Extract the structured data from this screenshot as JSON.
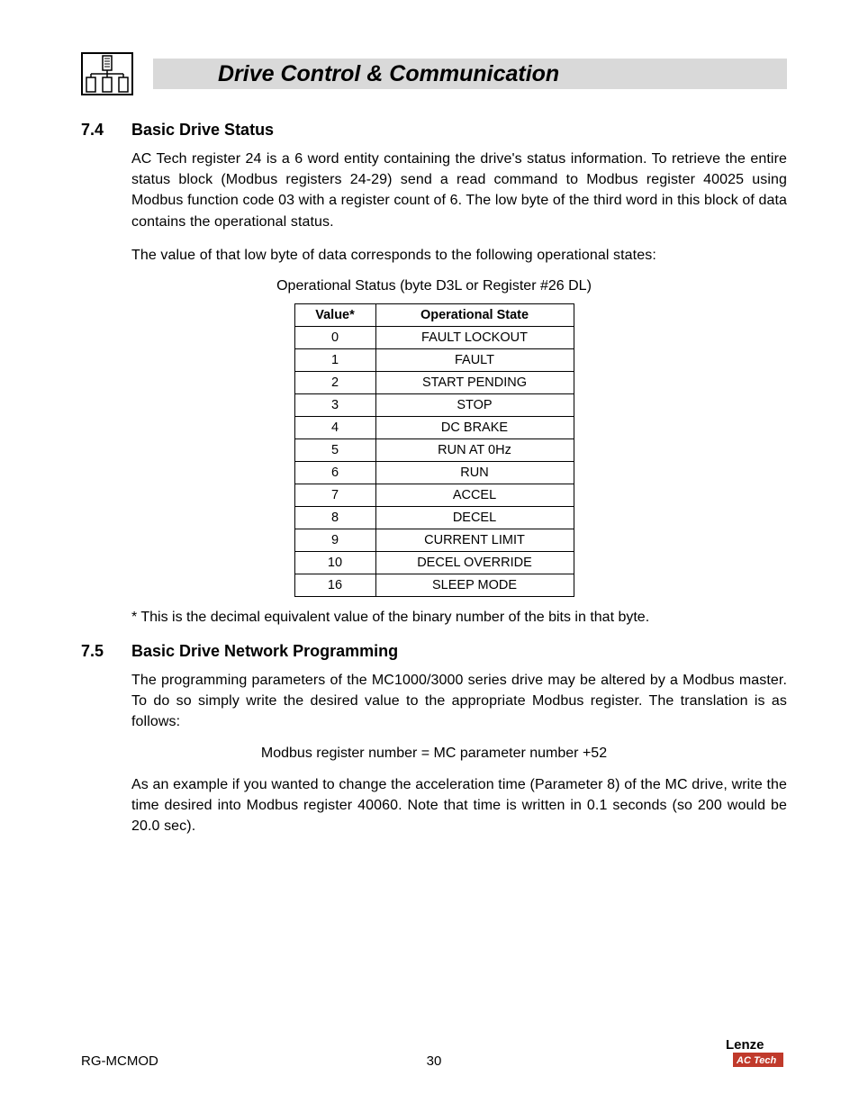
{
  "header": {
    "title": "Drive Control & Communication"
  },
  "section1": {
    "number": "7.4",
    "title": "Basic Drive Status",
    "para1": "AC Tech register 24 is a 6 word entity containing the drive's status information. To retrieve the entire status block (Modbus registers 24-29) send a read command to Modbus register 40025 using Modbus function code 03 with a register count of 6. The low byte of the third word in this block of data contains the operational status.",
    "para2": "The value of that low byte of data corresponds to the following operational states:",
    "table_caption": "Operational Status (byte D3L or Register #26 DL)",
    "col1": "Value*",
    "col2": "Operational State",
    "rows": [
      {
        "v": "0",
        "s": "FAULT LOCKOUT"
      },
      {
        "v": "1",
        "s": "FAULT"
      },
      {
        "v": "2",
        "s": "START PENDING"
      },
      {
        "v": "3",
        "s": "STOP"
      },
      {
        "v": "4",
        "s": "DC BRAKE"
      },
      {
        "v": "5",
        "s": "RUN AT 0Hz"
      },
      {
        "v": "6",
        "s": "RUN"
      },
      {
        "v": "7",
        "s": "ACCEL"
      },
      {
        "v": "8",
        "s": "DECEL"
      },
      {
        "v": "9",
        "s": "CURRENT LIMIT"
      },
      {
        "v": "10",
        "s": "DECEL OVERRIDE"
      },
      {
        "v": "16",
        "s": "SLEEP MODE"
      }
    ],
    "footnote": "* This is the decimal equivalent value of the binary number of the bits in that byte."
  },
  "section2": {
    "number": "7.5",
    "title": "Basic Drive Network Programming",
    "para1": "The programming parameters of the MC1000/3000 series drive may be altered by a Modbus master. To do so simply write the desired value to the appropriate Modbus register. The translation is as follows:",
    "equation": "Modbus register number = MC parameter number +52",
    "para2": "As an example if you wanted to change the acceleration time (Parameter 8) of the MC drive, write the time desired into Modbus register 40060. Note that time is written in 0.1 seconds (so 200 would be 20.0 sec)."
  },
  "footer": {
    "doc_id": "RG-MCMOD",
    "page": "30",
    "brand": "Lenze",
    "subbrand": "AC Tech"
  }
}
